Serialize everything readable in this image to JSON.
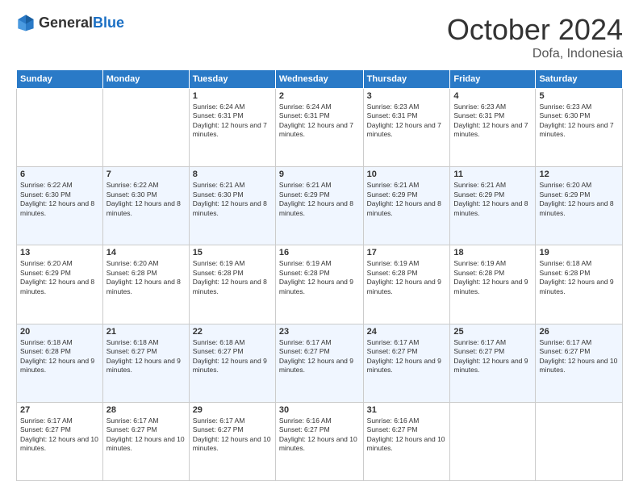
{
  "logo": {
    "general": "General",
    "blue": "Blue"
  },
  "header": {
    "month": "October 2024",
    "location": "Dofa, Indonesia"
  },
  "weekdays": [
    "Sunday",
    "Monday",
    "Tuesday",
    "Wednesday",
    "Thursday",
    "Friday",
    "Saturday"
  ],
  "weeks": [
    [
      {
        "day": "",
        "sunrise": "",
        "sunset": "",
        "daylight": ""
      },
      {
        "day": "",
        "sunrise": "",
        "sunset": "",
        "daylight": ""
      },
      {
        "day": "1",
        "sunrise": "Sunrise: 6:24 AM",
        "sunset": "Sunset: 6:31 PM",
        "daylight": "Daylight: 12 hours and 7 minutes."
      },
      {
        "day": "2",
        "sunrise": "Sunrise: 6:24 AM",
        "sunset": "Sunset: 6:31 PM",
        "daylight": "Daylight: 12 hours and 7 minutes."
      },
      {
        "day": "3",
        "sunrise": "Sunrise: 6:23 AM",
        "sunset": "Sunset: 6:31 PM",
        "daylight": "Daylight: 12 hours and 7 minutes."
      },
      {
        "day": "4",
        "sunrise": "Sunrise: 6:23 AM",
        "sunset": "Sunset: 6:31 PM",
        "daylight": "Daylight: 12 hours and 7 minutes."
      },
      {
        "day": "5",
        "sunrise": "Sunrise: 6:23 AM",
        "sunset": "Sunset: 6:30 PM",
        "daylight": "Daylight: 12 hours and 7 minutes."
      }
    ],
    [
      {
        "day": "6",
        "sunrise": "Sunrise: 6:22 AM",
        "sunset": "Sunset: 6:30 PM",
        "daylight": "Daylight: 12 hours and 8 minutes."
      },
      {
        "day": "7",
        "sunrise": "Sunrise: 6:22 AM",
        "sunset": "Sunset: 6:30 PM",
        "daylight": "Daylight: 12 hours and 8 minutes."
      },
      {
        "day": "8",
        "sunrise": "Sunrise: 6:21 AM",
        "sunset": "Sunset: 6:30 PM",
        "daylight": "Daylight: 12 hours and 8 minutes."
      },
      {
        "day": "9",
        "sunrise": "Sunrise: 6:21 AM",
        "sunset": "Sunset: 6:29 PM",
        "daylight": "Daylight: 12 hours and 8 minutes."
      },
      {
        "day": "10",
        "sunrise": "Sunrise: 6:21 AM",
        "sunset": "Sunset: 6:29 PM",
        "daylight": "Daylight: 12 hours and 8 minutes."
      },
      {
        "day": "11",
        "sunrise": "Sunrise: 6:21 AM",
        "sunset": "Sunset: 6:29 PM",
        "daylight": "Daylight: 12 hours and 8 minutes."
      },
      {
        "day": "12",
        "sunrise": "Sunrise: 6:20 AM",
        "sunset": "Sunset: 6:29 PM",
        "daylight": "Daylight: 12 hours and 8 minutes."
      }
    ],
    [
      {
        "day": "13",
        "sunrise": "Sunrise: 6:20 AM",
        "sunset": "Sunset: 6:29 PM",
        "daylight": "Daylight: 12 hours and 8 minutes."
      },
      {
        "day": "14",
        "sunrise": "Sunrise: 6:20 AM",
        "sunset": "Sunset: 6:28 PM",
        "daylight": "Daylight: 12 hours and 8 minutes."
      },
      {
        "day": "15",
        "sunrise": "Sunrise: 6:19 AM",
        "sunset": "Sunset: 6:28 PM",
        "daylight": "Daylight: 12 hours and 8 minutes."
      },
      {
        "day": "16",
        "sunrise": "Sunrise: 6:19 AM",
        "sunset": "Sunset: 6:28 PM",
        "daylight": "Daylight: 12 hours and 9 minutes."
      },
      {
        "day": "17",
        "sunrise": "Sunrise: 6:19 AM",
        "sunset": "Sunset: 6:28 PM",
        "daylight": "Daylight: 12 hours and 9 minutes."
      },
      {
        "day": "18",
        "sunrise": "Sunrise: 6:19 AM",
        "sunset": "Sunset: 6:28 PM",
        "daylight": "Daylight: 12 hours and 9 minutes."
      },
      {
        "day": "19",
        "sunrise": "Sunrise: 6:18 AM",
        "sunset": "Sunset: 6:28 PM",
        "daylight": "Daylight: 12 hours and 9 minutes."
      }
    ],
    [
      {
        "day": "20",
        "sunrise": "Sunrise: 6:18 AM",
        "sunset": "Sunset: 6:28 PM",
        "daylight": "Daylight: 12 hours and 9 minutes."
      },
      {
        "day": "21",
        "sunrise": "Sunrise: 6:18 AM",
        "sunset": "Sunset: 6:27 PM",
        "daylight": "Daylight: 12 hours and 9 minutes."
      },
      {
        "day": "22",
        "sunrise": "Sunrise: 6:18 AM",
        "sunset": "Sunset: 6:27 PM",
        "daylight": "Daylight: 12 hours and 9 minutes."
      },
      {
        "day": "23",
        "sunrise": "Sunrise: 6:17 AM",
        "sunset": "Sunset: 6:27 PM",
        "daylight": "Daylight: 12 hours and 9 minutes."
      },
      {
        "day": "24",
        "sunrise": "Sunrise: 6:17 AM",
        "sunset": "Sunset: 6:27 PM",
        "daylight": "Daylight: 12 hours and 9 minutes."
      },
      {
        "day": "25",
        "sunrise": "Sunrise: 6:17 AM",
        "sunset": "Sunset: 6:27 PM",
        "daylight": "Daylight: 12 hours and 9 minutes."
      },
      {
        "day": "26",
        "sunrise": "Sunrise: 6:17 AM",
        "sunset": "Sunset: 6:27 PM",
        "daylight": "Daylight: 12 hours and 10 minutes."
      }
    ],
    [
      {
        "day": "27",
        "sunrise": "Sunrise: 6:17 AM",
        "sunset": "Sunset: 6:27 PM",
        "daylight": "Daylight: 12 hours and 10 minutes."
      },
      {
        "day": "28",
        "sunrise": "Sunrise: 6:17 AM",
        "sunset": "Sunset: 6:27 PM",
        "daylight": "Daylight: 12 hours and 10 minutes."
      },
      {
        "day": "29",
        "sunrise": "Sunrise: 6:17 AM",
        "sunset": "Sunset: 6:27 PM",
        "daylight": "Daylight: 12 hours and 10 minutes."
      },
      {
        "day": "30",
        "sunrise": "Sunrise: 6:16 AM",
        "sunset": "Sunset: 6:27 PM",
        "daylight": "Daylight: 12 hours and 10 minutes."
      },
      {
        "day": "31",
        "sunrise": "Sunrise: 6:16 AM",
        "sunset": "Sunset: 6:27 PM",
        "daylight": "Daylight: 12 hours and 10 minutes."
      },
      {
        "day": "",
        "sunrise": "",
        "sunset": "",
        "daylight": ""
      },
      {
        "day": "",
        "sunrise": "",
        "sunset": "",
        "daylight": ""
      }
    ]
  ]
}
